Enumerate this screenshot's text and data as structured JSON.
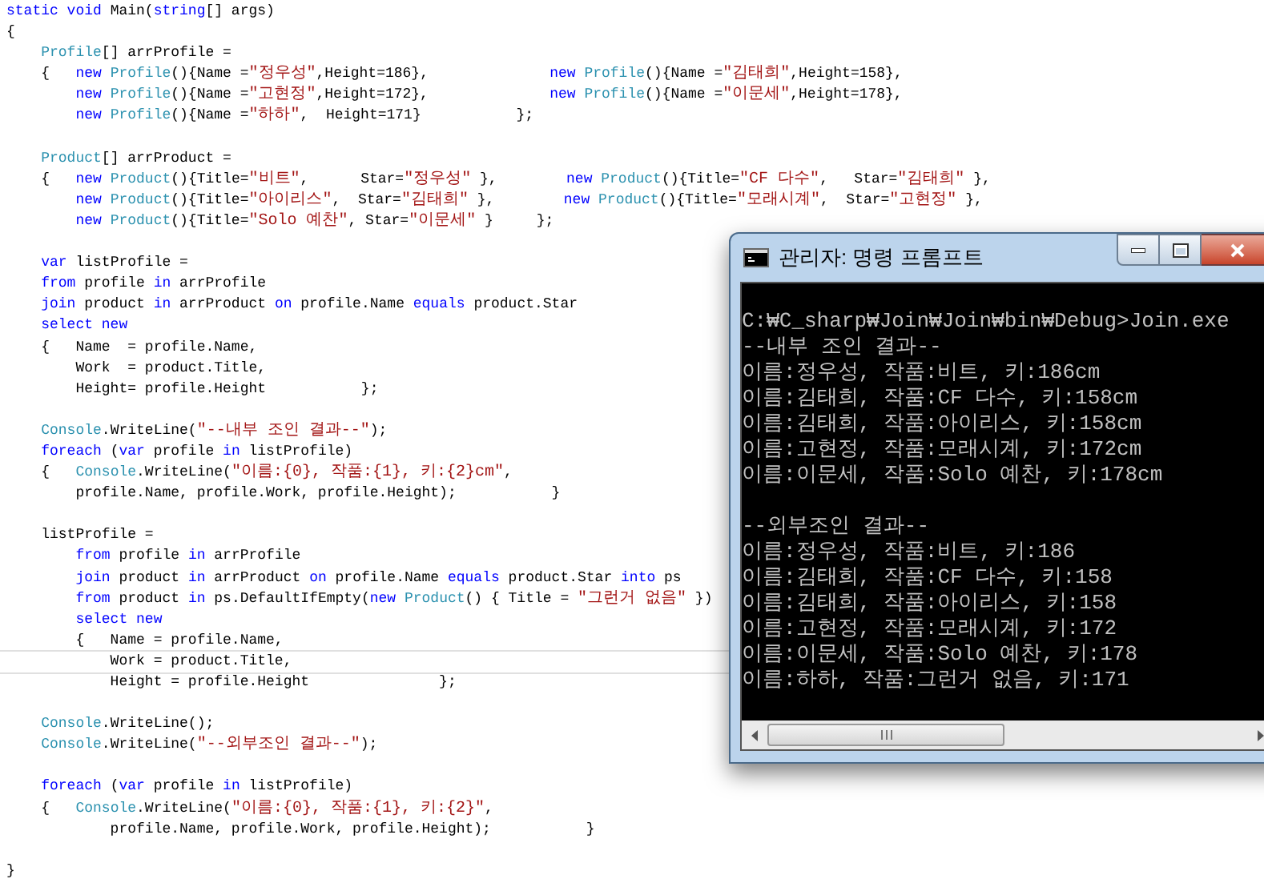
{
  "editor": {
    "blocks": [
      {
        "lines": [
          {
            "current": false,
            "tokens": [
              {
                "kind": "kw",
                "text": "static void "
              },
              {
                "kind": "p",
                "text": "Main("
              },
              {
                "kind": "kw",
                "text": "string"
              },
              {
                "kind": "p",
                "text": "[] args)"
              }
            ]
          },
          {
            "current": false,
            "tokens": [
              {
                "kind": "p",
                "text": "{"
              }
            ]
          },
          {
            "current": false,
            "tokens": [
              {
                "kind": "type",
                "text": "    Profile"
              },
              {
                "kind": "p",
                "text": "[] arrProfile ="
              }
            ]
          },
          {
            "current": false,
            "tokens": [
              {
                "kind": "p",
                "text": "    {   "
              },
              {
                "kind": "kw",
                "text": "new "
              },
              {
                "kind": "type",
                "text": "Profile"
              },
              {
                "kind": "p",
                "text": "(){Name ="
              },
              {
                "kind": "str",
                "text": "\"정우성\""
              },
              {
                "kind": "p",
                "text": ",Height=186},              "
              },
              {
                "kind": "kw",
                "text": "new "
              },
              {
                "kind": "type",
                "text": "Profile"
              },
              {
                "kind": "p",
                "text": "(){Name ="
              },
              {
                "kind": "str",
                "text": "\"김태희\""
              },
              {
                "kind": "p",
                "text": ",Height=158},"
              }
            ]
          },
          {
            "current": false,
            "tokens": [
              {
                "kind": "kw",
                "text": "        new "
              },
              {
                "kind": "type",
                "text": "Profile"
              },
              {
                "kind": "p",
                "text": "(){Name ="
              },
              {
                "kind": "str",
                "text": "\"고현정\""
              },
              {
                "kind": "p",
                "text": ",Height=172},              "
              },
              {
                "kind": "kw",
                "text": "new "
              },
              {
                "kind": "type",
                "text": "Profile"
              },
              {
                "kind": "p",
                "text": "(){Name ="
              },
              {
                "kind": "str",
                "text": "\"이문세\""
              },
              {
                "kind": "p",
                "text": ",Height=178},"
              }
            ]
          },
          {
            "current": false,
            "tokens": [
              {
                "kind": "kw",
                "text": "        new "
              },
              {
                "kind": "type",
                "text": "Profile"
              },
              {
                "kind": "p",
                "text": "(){Name ="
              },
              {
                "kind": "str",
                "text": "\"하하\""
              },
              {
                "kind": "p",
                "text": ",  Height=171}           };"
              }
            ]
          }
        ]
      },
      {
        "lines": [
          {
            "current": false,
            "tokens": [
              {
                "kind": "type",
                "text": "    Product"
              },
              {
                "kind": "p",
                "text": "[] arrProduct ="
              }
            ]
          },
          {
            "current": false,
            "tokens": [
              {
                "kind": "p",
                "text": "    {   "
              },
              {
                "kind": "kw",
                "text": "new "
              },
              {
                "kind": "type",
                "text": "Product"
              },
              {
                "kind": "p",
                "text": "(){Title="
              },
              {
                "kind": "str",
                "text": "\"비트\""
              },
              {
                "kind": "p",
                "text": ",      Star="
              },
              {
                "kind": "str",
                "text": "\"정우성\""
              },
              {
                "kind": "p",
                "text": " },        "
              },
              {
                "kind": "kw",
                "text": "new "
              },
              {
                "kind": "type",
                "text": "Product"
              },
              {
                "kind": "p",
                "text": "(){Title="
              },
              {
                "kind": "str",
                "text": "\"CF 다수\""
              },
              {
                "kind": "p",
                "text": ",   Star="
              },
              {
                "kind": "str",
                "text": "\"김태희\""
              },
              {
                "kind": "p",
                "text": " },"
              }
            ]
          },
          {
            "current": false,
            "tokens": [
              {
                "kind": "kw",
                "text": "        new "
              },
              {
                "kind": "type",
                "text": "Product"
              },
              {
                "kind": "p",
                "text": "(){Title="
              },
              {
                "kind": "str",
                "text": "\"아이리스\""
              },
              {
                "kind": "p",
                "text": ",  Star="
              },
              {
                "kind": "str",
                "text": "\"김태희\""
              },
              {
                "kind": "p",
                "text": " },        "
              },
              {
                "kind": "kw",
                "text": "new "
              },
              {
                "kind": "type",
                "text": "Product"
              },
              {
                "kind": "p",
                "text": "(){Title="
              },
              {
                "kind": "str",
                "text": "\"모래시계\""
              },
              {
                "kind": "p",
                "text": ",  Star="
              },
              {
                "kind": "str",
                "text": "\"고현정\""
              },
              {
                "kind": "p",
                "text": " },"
              }
            ]
          },
          {
            "current": false,
            "tokens": [
              {
                "kind": "kw",
                "text": "        new "
              },
              {
                "kind": "type",
                "text": "Product"
              },
              {
                "kind": "p",
                "text": "(){Title="
              },
              {
                "kind": "str",
                "text": "\"Solo 예찬\""
              },
              {
                "kind": "p",
                "text": ", Star="
              },
              {
                "kind": "str",
                "text": "\"이문세\""
              },
              {
                "kind": "p",
                "text": " }     };"
              }
            ]
          }
        ]
      },
      {
        "lines": [
          {
            "current": false,
            "tokens": [
              {
                "kind": "kw",
                "text": "    var "
              },
              {
                "kind": "p",
                "text": "listProfile ="
              }
            ]
          },
          {
            "current": false,
            "tokens": [
              {
                "kind": "kw",
                "text": "    from "
              },
              {
                "kind": "p",
                "text": "profile "
              },
              {
                "kind": "kw",
                "text": "in "
              },
              {
                "kind": "p",
                "text": "arrProfile"
              }
            ]
          },
          {
            "current": false,
            "tokens": [
              {
                "kind": "kw",
                "text": "    join "
              },
              {
                "kind": "p",
                "text": "product "
              },
              {
                "kind": "kw",
                "text": "in "
              },
              {
                "kind": "p",
                "text": "arrProduct "
              },
              {
                "kind": "kw",
                "text": "on "
              },
              {
                "kind": "p",
                "text": "profile.Name "
              },
              {
                "kind": "kw",
                "text": "equals "
              },
              {
                "kind": "p",
                "text": "product.Star"
              }
            ]
          },
          {
            "current": false,
            "tokens": [
              {
                "kind": "kw",
                "text": "    select new"
              }
            ]
          },
          {
            "current": false,
            "tokens": [
              {
                "kind": "p",
                "text": "    {   Name  = profile.Name,"
              }
            ]
          },
          {
            "current": false,
            "tokens": [
              {
                "kind": "p",
                "text": "        Work  = product.Title,"
              }
            ]
          },
          {
            "current": false,
            "tokens": [
              {
                "kind": "p",
                "text": "        Height= profile.Height           };"
              }
            ]
          }
        ]
      },
      {
        "lines": [
          {
            "current": false,
            "tokens": [
              {
                "kind": "type",
                "text": "    Console"
              },
              {
                "kind": "p",
                "text": ".WriteLine("
              },
              {
                "kind": "str",
                "text": "\"--내부 조인 결과--\""
              },
              {
                "kind": "p",
                "text": ");"
              }
            ]
          },
          {
            "current": false,
            "tokens": [
              {
                "kind": "kw",
                "text": "    foreach "
              },
              {
                "kind": "p",
                "text": "("
              },
              {
                "kind": "kw",
                "text": "var "
              },
              {
                "kind": "p",
                "text": "profile "
              },
              {
                "kind": "kw",
                "text": "in "
              },
              {
                "kind": "p",
                "text": "listProfile)"
              }
            ]
          },
          {
            "current": false,
            "tokens": [
              {
                "kind": "p",
                "text": "    {   "
              },
              {
                "kind": "type",
                "text": "Console"
              },
              {
                "kind": "p",
                "text": ".WriteLine("
              },
              {
                "kind": "str",
                "text": "\"이름:{0}, 작품:{1}, 키:{2}cm\""
              },
              {
                "kind": "p",
                "text": ","
              }
            ]
          },
          {
            "current": false,
            "tokens": [
              {
                "kind": "p",
                "text": "        profile.Name, profile.Work, profile.Height);           }"
              }
            ]
          }
        ]
      },
      {
        "lines": [
          {
            "current": false,
            "tokens": [
              {
                "kind": "p",
                "text": "    listProfile ="
              }
            ]
          },
          {
            "current": false,
            "tokens": [
              {
                "kind": "kw",
                "text": "        from "
              },
              {
                "kind": "p",
                "text": "profile "
              },
              {
                "kind": "kw",
                "text": "in "
              },
              {
                "kind": "p",
                "text": "arrProfile"
              }
            ]
          },
          {
            "current": false,
            "tokens": [
              {
                "kind": "kw",
                "text": "        join "
              },
              {
                "kind": "p",
                "text": "product "
              },
              {
                "kind": "kw",
                "text": "in "
              },
              {
                "kind": "p",
                "text": "arrProduct "
              },
              {
                "kind": "kw",
                "text": "on "
              },
              {
                "kind": "p",
                "text": "profile.Name "
              },
              {
                "kind": "kw",
                "text": "equals "
              },
              {
                "kind": "p",
                "text": "product.Star "
              },
              {
                "kind": "kw",
                "text": "into "
              },
              {
                "kind": "p",
                "text": "ps"
              }
            ]
          },
          {
            "current": false,
            "tokens": [
              {
                "kind": "kw",
                "text": "        from "
              },
              {
                "kind": "p",
                "text": "product "
              },
              {
                "kind": "kw",
                "text": "in "
              },
              {
                "kind": "p",
                "text": "ps.DefaultIfEmpty("
              },
              {
                "kind": "kw",
                "text": "new "
              },
              {
                "kind": "type",
                "text": "Product"
              },
              {
                "kind": "p",
                "text": "() { Title = "
              },
              {
                "kind": "str",
                "text": "\"그런거 없음\""
              },
              {
                "kind": "p",
                "text": " })"
              }
            ]
          },
          {
            "current": false,
            "tokens": [
              {
                "kind": "kw",
                "text": "        select new"
              }
            ]
          },
          {
            "current": false,
            "tokens": [
              {
                "kind": "p",
                "text": "        {   Name = profile.Name,"
              }
            ]
          },
          {
            "current": true,
            "tokens": [
              {
                "kind": "p",
                "text": "            Work = product.Title,"
              }
            ]
          },
          {
            "current": false,
            "tokens": [
              {
                "kind": "p",
                "text": "            Height = profile.Height               };"
              }
            ]
          }
        ]
      },
      {
        "lines": [
          {
            "current": false,
            "tokens": [
              {
                "kind": "type",
                "text": "    Console"
              },
              {
                "kind": "p",
                "text": ".WriteLine();"
              }
            ]
          },
          {
            "current": false,
            "tokens": [
              {
                "kind": "type",
                "text": "    Console"
              },
              {
                "kind": "p",
                "text": ".WriteLine("
              },
              {
                "kind": "str",
                "text": "\"--외부조인 결과--\""
              },
              {
                "kind": "p",
                "text": ");"
              }
            ]
          }
        ]
      },
      {
        "lines": [
          {
            "current": false,
            "tokens": [
              {
                "kind": "kw",
                "text": "    foreach "
              },
              {
                "kind": "p",
                "text": "("
              },
              {
                "kind": "kw",
                "text": "var "
              },
              {
                "kind": "p",
                "text": "profile "
              },
              {
                "kind": "kw",
                "text": "in "
              },
              {
                "kind": "p",
                "text": "listProfile)"
              }
            ]
          },
          {
            "current": false,
            "tokens": [
              {
                "kind": "p",
                "text": "    {   "
              },
              {
                "kind": "type",
                "text": "Console"
              },
              {
                "kind": "p",
                "text": ".WriteLine("
              },
              {
                "kind": "str",
                "text": "\"이름:{0}, 작품:{1}, 키:{2}\""
              },
              {
                "kind": "p",
                "text": ","
              }
            ]
          },
          {
            "current": false,
            "tokens": [
              {
                "kind": "p",
                "text": "            profile.Name, profile.Work, profile.Height);           }"
              }
            ]
          }
        ]
      },
      {
        "lines": [
          {
            "current": false,
            "tokens": [
              {
                "kind": "p",
                "text": "}"
              }
            ]
          }
        ]
      }
    ]
  },
  "console": {
    "title": "관리자: 명령 프롬프트",
    "output": [
      {
        "lines": [
          "C:₩C_sharp₩Join₩Join₩bin₩Debug>Join.exe",
          "--내부 조인 결과--",
          "이름:정우성, 작품:비트, 키:186cm",
          "이름:김태희, 작품:CF 다수, 키:158cm",
          "이름:김태희, 작품:아이리스, 키:158cm",
          "이름:고현정, 작품:모래시계, 키:172cm",
          "이름:이문세, 작품:Solo 예찬, 키:178cm"
        ]
      },
      {
        "lines": [
          "--외부조인 결과--",
          "이름:정우성, 작품:비트, 키:186",
          "이름:김태희, 작품:CF 다수, 키:158",
          "이름:김태희, 작품:아이리스, 키:158",
          "이름:고현정, 작품:모래시계, 키:172",
          "이름:이문세, 작품:Solo 예찬, 키:178",
          "이름:하하, 작품:그런거 없음, 키:171"
        ]
      }
    ]
  }
}
